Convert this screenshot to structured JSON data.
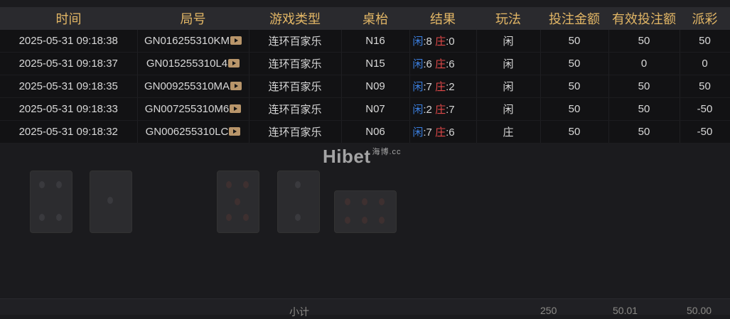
{
  "columns": [
    "时间",
    "局号",
    "游戏类型",
    "桌枱",
    "结果",
    "玩法",
    "投注金额",
    "有效投注额",
    "派彩"
  ],
  "rows": [
    {
      "time": "2025-05-31 09:18:38",
      "round": "GN016255310KM",
      "game": "连环百家乐",
      "table": "N16",
      "player_label": "闲",
      "player_score": ":8",
      "banker_label": "庄",
      "banker_score": ":0",
      "play": "闲",
      "bet": "50",
      "valid": "50",
      "payout": "50",
      "payout_sign": "pos"
    },
    {
      "time": "2025-05-31 09:18:37",
      "round": "GN015255310L4",
      "game": "连环百家乐",
      "table": "N15",
      "player_label": "闲",
      "player_score": ":6",
      "banker_label": "庄",
      "banker_score": ":6",
      "play": "闲",
      "bet": "50",
      "valid": "0",
      "payout": "0",
      "payout_sign": "zero"
    },
    {
      "time": "2025-05-31 09:18:35",
      "round": "GN009255310MA",
      "game": "连环百家乐",
      "table": "N09",
      "player_label": "闲",
      "player_score": ":7",
      "banker_label": "庄",
      "banker_score": ":2",
      "play": "闲",
      "bet": "50",
      "valid": "50",
      "payout": "50",
      "payout_sign": "pos"
    },
    {
      "time": "2025-05-31 09:18:33",
      "round": "GN007255310M6",
      "game": "连环百家乐",
      "table": "N07",
      "player_label": "闲",
      "player_score": ":2",
      "banker_label": "庄",
      "banker_score": ":7",
      "play": "闲",
      "bet": "50",
      "valid": "50",
      "payout": "-50",
      "payout_sign": "neg"
    },
    {
      "time": "2025-05-31 09:18:32",
      "round": "GN006255310LC",
      "game": "连环百家乐",
      "table": "N06",
      "player_label": "闲",
      "player_score": ":7",
      "banker_label": "庄",
      "banker_score": ":6",
      "play": "庄",
      "bet": "50",
      "valid": "50",
      "payout": "-50",
      "payout_sign": "neg"
    }
  ],
  "footer": {
    "label": "小计",
    "bet_total": "250",
    "valid_total": "50.01",
    "payout_total": "50.00"
  },
  "watermark": {
    "main": "Hibet",
    "small": "海博.cc"
  },
  "icons": {
    "round_video": "play-video-icon",
    "result_info": "info-icon"
  },
  "colors": {
    "header_text": "#e3b766",
    "player": "#3b7fe0",
    "banker": "#e04848",
    "payout_positive": "#e03a3a",
    "payout_negative": "#4bb04b"
  }
}
